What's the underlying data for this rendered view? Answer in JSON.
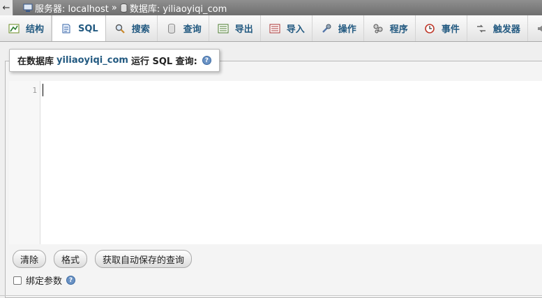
{
  "topbar": {
    "back_glyph": "←",
    "server_label": "服务器: localhost",
    "separator": "»",
    "database_label": "数据库: yiliaoyiqi_com"
  },
  "tabs": [
    {
      "label": "结构",
      "icon": "structure-icon"
    },
    {
      "label": "SQL",
      "icon": "sql-icon",
      "active": true
    },
    {
      "label": "搜索",
      "icon": "search-icon"
    },
    {
      "label": "查询",
      "icon": "query-icon"
    },
    {
      "label": "导出",
      "icon": "export-icon"
    },
    {
      "label": "导入",
      "icon": "import-icon"
    },
    {
      "label": "操作",
      "icon": "wrench-icon"
    },
    {
      "label": "程序",
      "icon": "routines-icon"
    },
    {
      "label": "事件",
      "icon": "clock-icon"
    },
    {
      "label": "触发器",
      "icon": "triggers-icon"
    }
  ],
  "query_box": {
    "legend_prefix": "在数据库",
    "database": "yiliaoyiqi_com",
    "legend_suffix": "运行 SQL 查询:",
    "help_glyph": "?"
  },
  "editor": {
    "line_number": "1",
    "content": ""
  },
  "buttons": {
    "clear": "清除",
    "format": "格式",
    "autosave": "获取自动保存的查询"
  },
  "bind_params": {
    "label": "绑定参数",
    "checked": false,
    "help_glyph": "?"
  },
  "colors": {
    "tab_text": "#235a81",
    "topbar": "#7a7a7a",
    "help_icon": "#6a92c4"
  }
}
